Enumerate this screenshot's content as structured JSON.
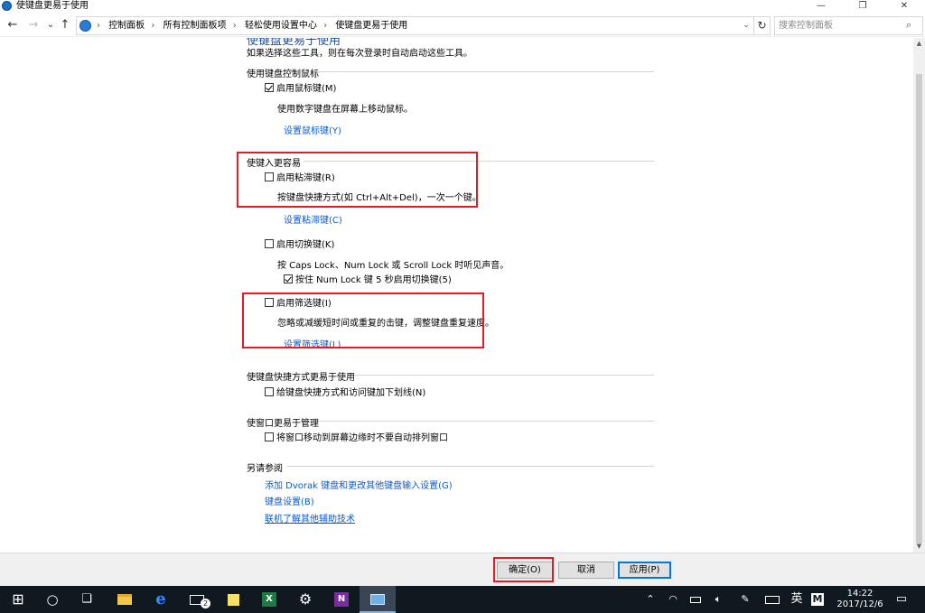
{
  "window": {
    "title": "使键盘更易于使用",
    "minimize": "—",
    "restore": "❐",
    "close": "✕"
  },
  "nav": {
    "back": "←",
    "forward": "→",
    "recent": "⌄",
    "up": "↑",
    "breadcrumbs": [
      "控制面板",
      "所有控制面板项",
      "轻松使用设置中心",
      "使键盘更易于使用"
    ],
    "breadcrumb_sep": "›",
    "dropdown": "⌄",
    "refresh": "↻",
    "search_placeholder": "搜索控制面板"
  },
  "page": {
    "heading": "使键盘更易于使用",
    "intro": "如果选择这些工具，则在每次登录时自动启动这些工具。",
    "mouse_section": {
      "title": "使用键盘控制鼠标",
      "mouse_keys_label": "启用鼠标键(M)",
      "mouse_keys_checked": true,
      "mouse_keys_desc": "使用数字键盘在屏幕上移动鼠标。",
      "setup_link": "设置鼠标键(Y)"
    },
    "typing_section": {
      "title": "使键入更容易",
      "sticky_label": "启用粘滞键(R)",
      "sticky_checked": false,
      "sticky_desc": "按键盘快捷方式(如 Ctrl+Alt+Del)，一次一个键。",
      "sticky_link": "设置粘滞键(C)",
      "toggle_label": "启用切换键(K)",
      "toggle_checked": false,
      "toggle_desc": "按 Caps Lock、Num Lock 或 Scroll Lock 时听见声音。",
      "numlock_label": "按住 Num Lock 键 5 秒启用切换键(5)",
      "numlock_checked": true,
      "filter_label": "启用筛选键(I)",
      "filter_checked": false,
      "filter_desc": "忽略或减缓短时间或重复的击键，调整键盘重复速度。",
      "filter_link": "设置筛选键(L)"
    },
    "shortcut_section": {
      "title": "使键盘快捷方式更易于使用",
      "underline_label": "给键盘快捷方式和访问键加下划线(N)",
      "underline_checked": false
    },
    "window_section": {
      "title": "使窗口更易于管理",
      "snap_label": "将窗口移动到屏幕边缘时不要自动排列窗口",
      "snap_checked": false
    },
    "see_also": {
      "title": "另请参阅",
      "links": [
        "添加 Dvorak 键盘和更改其他键盘输入设置(G)",
        "键盘设置(B)",
        "联机了解其他辅助技术"
      ]
    }
  },
  "buttons": {
    "ok": "确定(O)",
    "cancel": "取消",
    "apply": "应用(P)"
  },
  "taskbar": {
    "start_icon": "⊞",
    "search_icon": "○",
    "taskview_icon": "❏",
    "mail_badge": "2",
    "ime_lang": "英",
    "ime_mode": "M",
    "time": "14:22",
    "date": "2017/12/6"
  },
  "colors": {
    "link": "#0a5bd3",
    "highlight_box": "#e31b23",
    "taskbar": "#101820"
  }
}
